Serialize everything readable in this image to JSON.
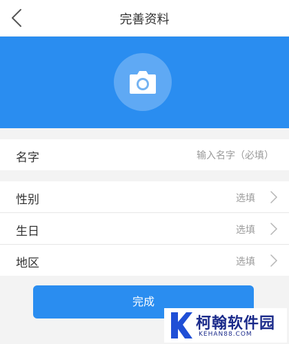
{
  "navbar": {
    "title": "完善资料"
  },
  "profile": {
    "camera_icon": "camera-icon"
  },
  "form": {
    "name": {
      "label": "名字",
      "placeholder": "输入名字（必填）",
      "value": ""
    },
    "rows": [
      {
        "key": "gender",
        "label": "性别",
        "value": "选填"
      },
      {
        "key": "birthday",
        "label": "生日",
        "value": "选填"
      },
      {
        "key": "region",
        "label": "地区",
        "value": "选填"
      }
    ]
  },
  "actions": {
    "done_label": "完成"
  },
  "watermark": {
    "name": "柯翰软件园",
    "domain": "KEHAN88.COM"
  },
  "colors": {
    "accent": "#2a8df0",
    "background": "#f3f3f3",
    "text": "#333333",
    "muted": "#9a9a9a"
  }
}
